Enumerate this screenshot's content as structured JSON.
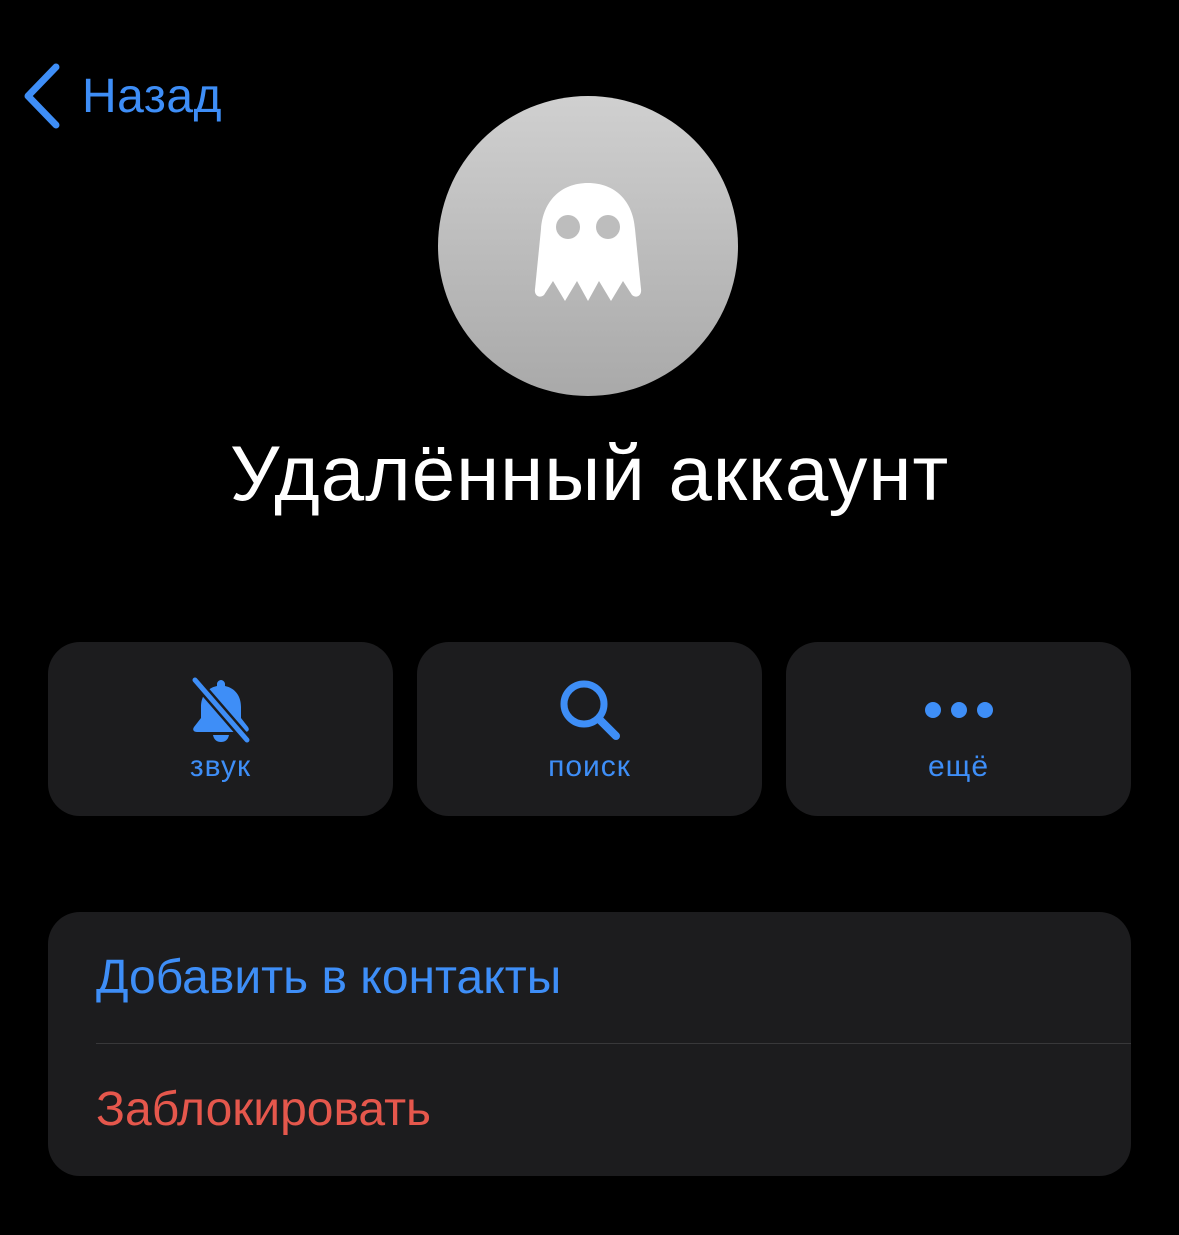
{
  "nav": {
    "back_label": "Назад"
  },
  "profile": {
    "avatar_icon": "ghost-icon",
    "name": "Удалённый аккаунт"
  },
  "actions": [
    {
      "icon": "bell-slash-icon",
      "label": "звук"
    },
    {
      "icon": "search-icon",
      "label": "поиск"
    },
    {
      "icon": "more-dots-icon",
      "label": "ещё"
    }
  ],
  "list": {
    "add_contact_label": "Добавить в контакты",
    "block_label": "Заблокировать"
  },
  "colors": {
    "accent": "#3e8ef7",
    "destructive": "#e5574c",
    "background": "#000000",
    "card": "#1c1c1e"
  }
}
